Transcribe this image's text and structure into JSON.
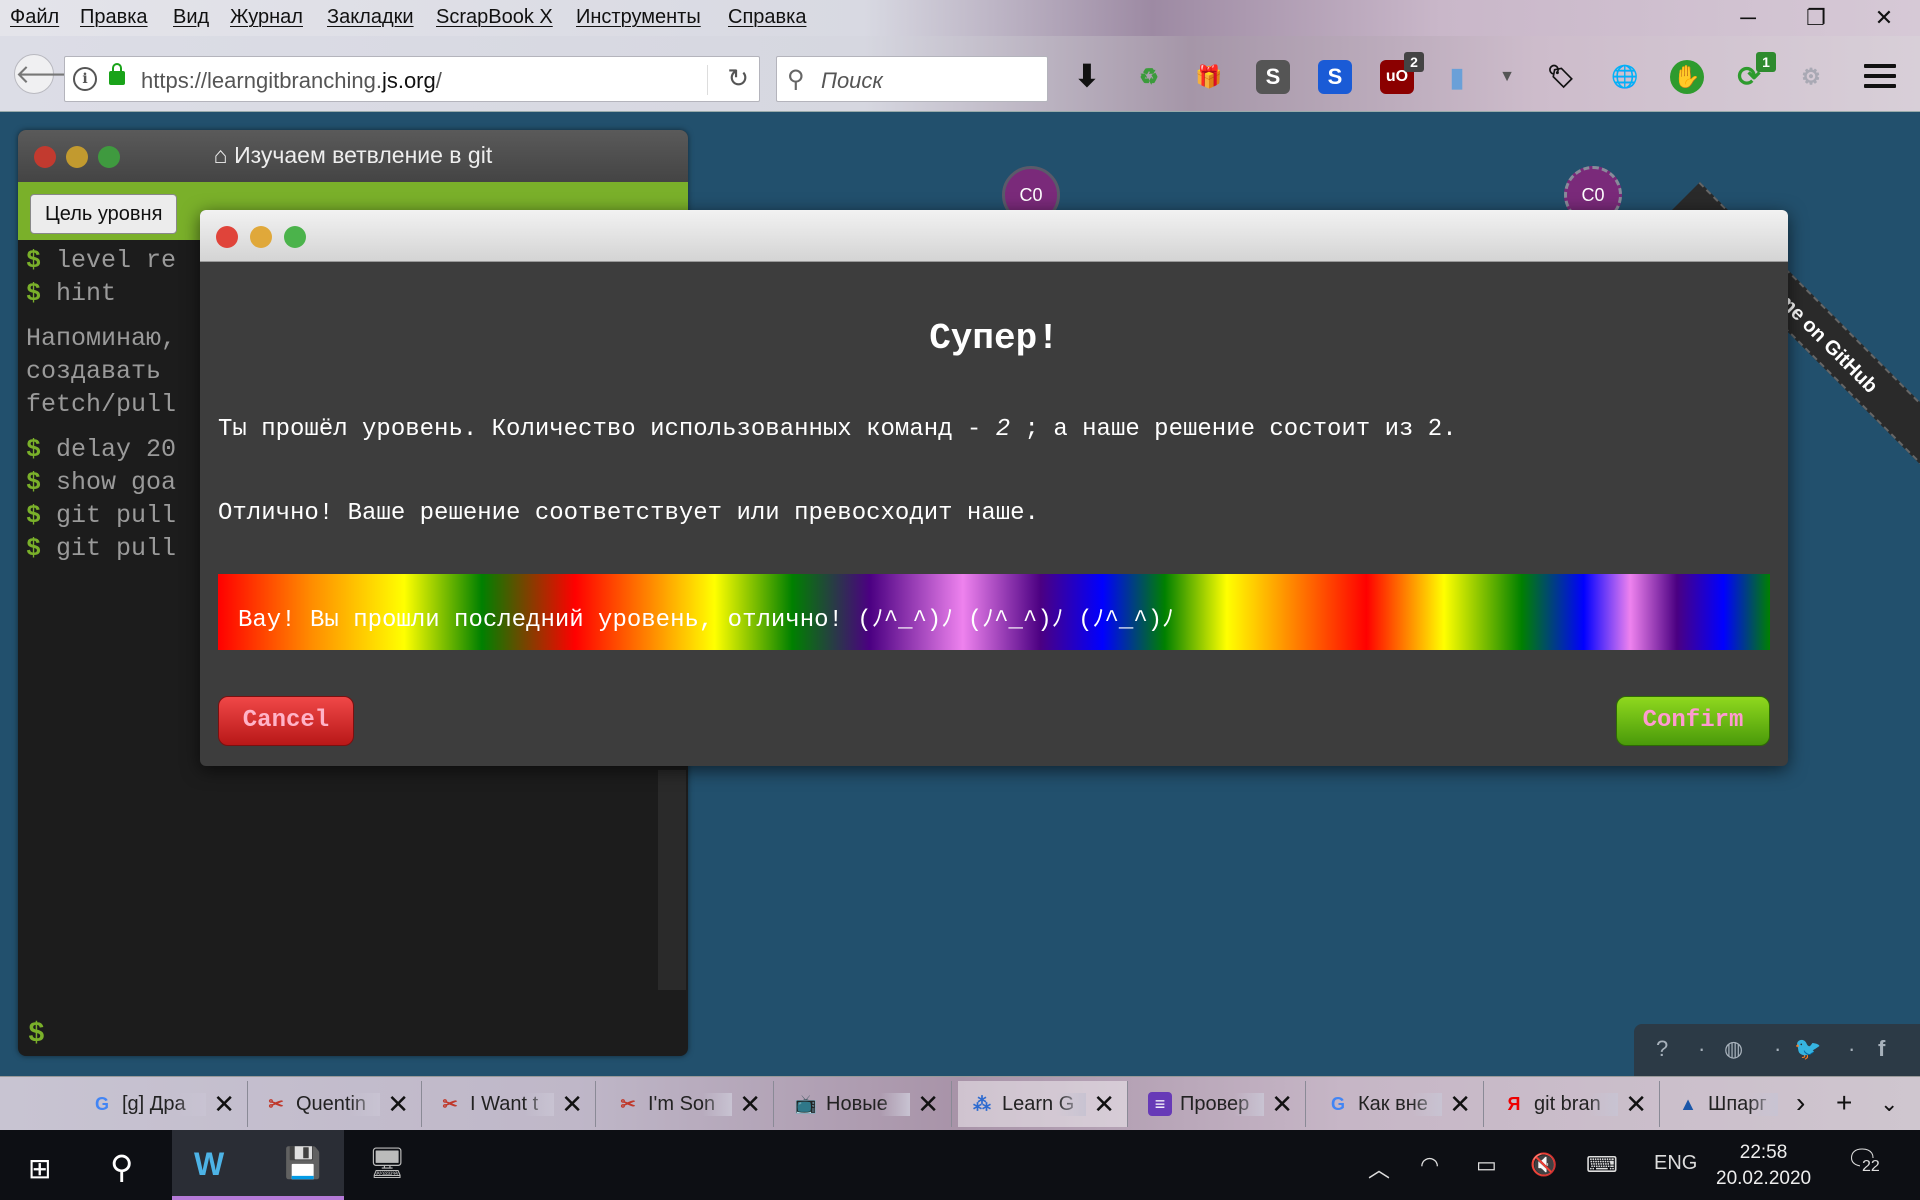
{
  "menu": [
    "Файл",
    "Правка",
    "Вид",
    "Журнал",
    "Закладки",
    "ScrapBook X",
    "Инструменты",
    "Справка"
  ],
  "window_controls": {
    "minimize": "─",
    "restore": "❐",
    "close": "✕"
  },
  "navbar": {
    "url_prefix": "https://learngitbranching.",
    "url_domain": "js.org",
    "url_suffix": "/",
    "search_placeholder": "Поиск",
    "addon_badges": {
      "ublock": "2",
      "sync": "1"
    }
  },
  "page": {
    "fork_ribbon": "Fork me on GitHub",
    "nodes": [
      "C0",
      "C0"
    ],
    "terminal": {
      "title": "Изучаем ветвление в git",
      "goal_button": "Цель уровня",
      "lines": [
        {
          "type": "cmd",
          "text": "level re"
        },
        {
          "type": "cmd",
          "text": "hint"
        },
        {
          "type": "note",
          "text": "Напоминаю,\nсоздавать \nfetch/pull"
        },
        {
          "type": "cmd",
          "text": "delay 20"
        },
        {
          "type": "cmd",
          "text": "show goa"
        },
        {
          "type": "cmd",
          "text": "git pull"
        },
        {
          "type": "cmd",
          "text": "git pull"
        }
      ],
      "prompt": "$"
    },
    "help_bar": [
      "?",
      "·",
      "◍",
      "·",
      "🐦",
      "·",
      "f"
    ]
  },
  "modal": {
    "title": "Супер!",
    "line1_a": "Ты прошёл уровень. Количество использованных команд - ",
    "line1_count": "2",
    "line1_b": " ; а наше решение состоит из 2.",
    "line2": "Отлично! Ваше решение соответствует или превосходит наше.",
    "rainbow": "Вау! Вы прошли последний уровень, отлично! (ﾉ^_^)ﾉ (ﾉ^_^)ﾉ (ﾉ^_^)ﾉ",
    "cancel": "Cancel",
    "confirm": "Confirm"
  },
  "tabs": [
    {
      "label": "[g] Дра",
      "icon": "G"
    },
    {
      "label": "Quentin",
      "icon": "✂"
    },
    {
      "label": "I Want t",
      "icon": "✂"
    },
    {
      "label": "I'm Son",
      "icon": "✂"
    },
    {
      "label": "Новые",
      "icon": "📺"
    },
    {
      "label": "Learn G",
      "icon": "⁂"
    },
    {
      "label": "Провер",
      "icon": "≡"
    },
    {
      "label": "Как вне",
      "icon": "G"
    },
    {
      "label": "git bran",
      "icon": "Я"
    },
    {
      "label": "Шпарг",
      "icon": "▲"
    }
  ],
  "taskbar": {
    "language": "ENG",
    "time": "22:58",
    "date": "20.02.2020",
    "notifications": "22"
  }
}
